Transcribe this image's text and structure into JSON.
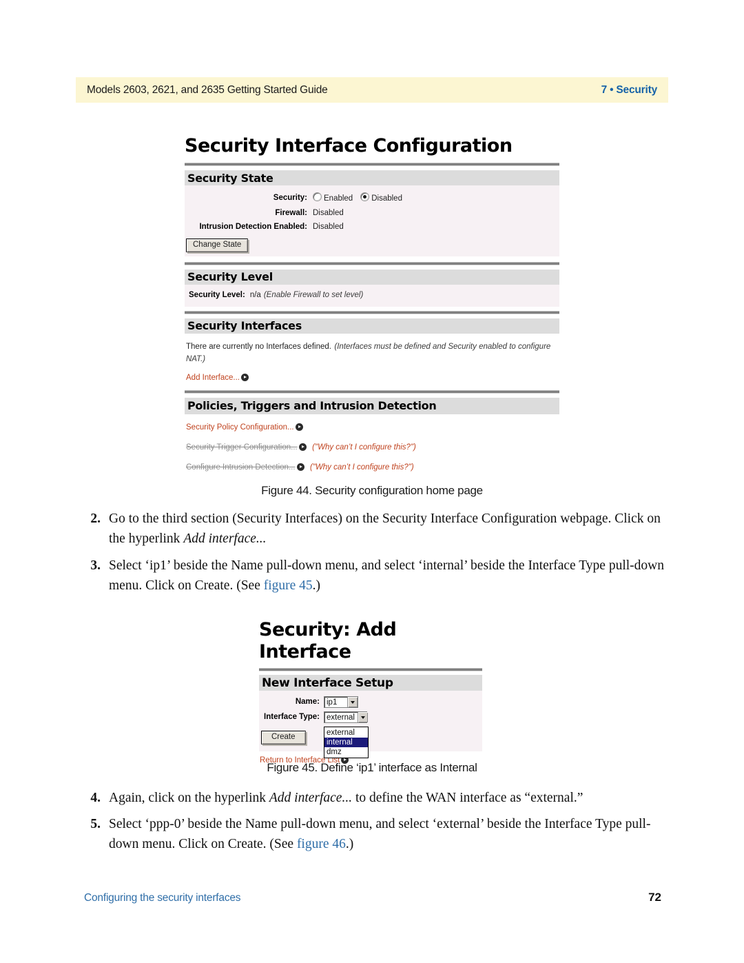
{
  "header": {
    "left": "Models 2603, 2621, and 2635 Getting Started Guide",
    "right": "7 • Security",
    "background": "#fcf6d2",
    "accent": "#1763a8"
  },
  "figure44": {
    "caption": "Figure 44. Security configuration home page",
    "page_title": "Security Interface Configuration",
    "sections": [
      {
        "heading": "Security State",
        "fields": [
          {
            "label": "Security:",
            "type": "radio-group",
            "options": [
              {
                "label": "Enabled",
                "selected": false
              },
              {
                "label": "Disabled",
                "selected": true
              }
            ]
          },
          {
            "label": "Firewall:",
            "type": "text",
            "value": "Disabled"
          },
          {
            "label": "Intrusion Detection Enabled:",
            "type": "text",
            "value": "Disabled"
          }
        ],
        "button": "Change State"
      },
      {
        "heading": "Security Level",
        "level_label": "Security Level:",
        "level_value": "n/a",
        "level_note": "(Enable Firewall to set level)"
      },
      {
        "heading": "Security Interfaces",
        "note_plain": "There are currently no Interfaces defined.",
        "note_italic": "(Interfaces must be defined and Security enabled to configure NAT.)",
        "link": "Add Interface..."
      },
      {
        "heading": "Policies, Triggers and Intrusion Detection",
        "links": [
          {
            "label": "Security Policy Configuration...",
            "disabled": false,
            "note": ""
          },
          {
            "label": "Security Trigger Configuration...",
            "disabled": true,
            "note": "(\"Why can’t I configure this?\")"
          },
          {
            "label": "Configure Intrusion Detection...",
            "disabled": true,
            "note": "(\"Why can’t I configure this?\")"
          }
        ]
      }
    ],
    "colors": {
      "band": "#dcdcdc",
      "body": "#f7f1f4",
      "link": "#c0431f",
      "disabled_link": "#8d8d8d"
    }
  },
  "figure45": {
    "caption": "Figure 45. Define ‘ip1’ interface as Internal",
    "page_title": "Security: Add Interface",
    "section_heading": "New Interface Setup",
    "name_label": "Name:",
    "name_value": "ip1",
    "type_label": "Interface Type:",
    "type_value": "external",
    "type_options": [
      {
        "label": "external",
        "selected": false
      },
      {
        "label": "internal",
        "selected": true
      },
      {
        "label": "dmz",
        "selected": false
      }
    ],
    "create_button": "Create",
    "return_link": "Return to Interface List",
    "highlight_color": "#1b1a7a"
  },
  "steps": [
    {
      "number": "2.",
      "parts": [
        {
          "t": "Go to the third section (Security Interfaces) on the Security Interface Configuration webpage. Click on the hyperlink ",
          "style": "normal"
        },
        {
          "t": "Add interface...",
          "style": "italic"
        }
      ]
    },
    {
      "number": "3.",
      "parts": [
        {
          "t": "Select ‘ip1’ beside the Name pull-down menu, and select ‘internal’ beside the Interface Type pull-down menu. Click on Create. (See ",
          "style": "normal"
        },
        {
          "t": "figure 45",
          "style": "xref"
        },
        {
          "t": ".)",
          "style": "normal"
        }
      ]
    },
    {
      "number": "4.",
      "parts": [
        {
          "t": "Again, click on the hyperlink ",
          "style": "normal"
        },
        {
          "t": "Add interface...",
          "style": "italic"
        },
        {
          "t": " to define the WAN interface as “external.”",
          "style": "normal"
        }
      ]
    },
    {
      "number": "5.",
      "parts": [
        {
          "t": "Select ‘ppp-0’ beside the Name pull-down menu, and select ‘external’ beside the Interface Type pull-down menu. Click on Create. (See ",
          "style": "normal"
        },
        {
          "t": "figure 46",
          "style": "xref"
        },
        {
          "t": ".)",
          "style": "normal"
        }
      ]
    }
  ],
  "footer": {
    "left": "Configuring the security interfaces",
    "page_number": "72",
    "accent": "#2f6ea8"
  }
}
